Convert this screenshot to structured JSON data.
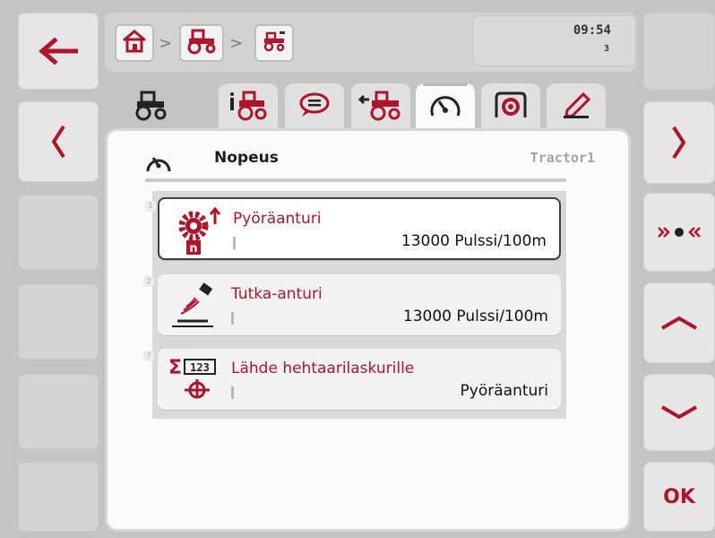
{
  "header": {
    "time": "09:54",
    "counter": "3",
    "breadcrumb": [
      "home-icon",
      "tractor-icon",
      "tractor-small-icon"
    ],
    "separator": ">"
  },
  "tabs": [
    {
      "name": "tractor",
      "icon": "tractor-icon"
    },
    {
      "name": "tractor-info",
      "icon": "tractor-info-icon"
    },
    {
      "name": "messages",
      "icon": "speech-bubble-icon"
    },
    {
      "name": "hitch",
      "icon": "tractor-hitch-icon"
    },
    {
      "name": "speed",
      "icon": "speedometer-icon",
      "active": true
    },
    {
      "name": "pto",
      "icon": "pto-icon"
    },
    {
      "name": "edit",
      "icon": "pencil-icon"
    }
  ],
  "panel": {
    "title": "Nopeus",
    "subtitle": "Tractor1",
    "items": [
      {
        "index": "1",
        "label": "Pyöräanturi",
        "value": "13000 Pulssi/100m",
        "icon": "wheel-sensor-icon"
      },
      {
        "index": "2",
        "label": "Tutka-anturi",
        "value": "13000 Pulssi/100m",
        "icon": "radar-sensor-icon"
      },
      {
        "index": "7",
        "label": "Lähde hehtaarilaskurille",
        "value": "Pyöräanturi",
        "icon": "hectare-counter-source-icon"
      }
    ]
  },
  "side_left": [
    {
      "name": "back",
      "icon": "arrow-left-icon"
    },
    {
      "name": "previous",
      "icon": "chevron-left-icon"
    },
    {
      "name": "empty-1"
    },
    {
      "name": "empty-2"
    },
    {
      "name": "empty-3"
    },
    {
      "name": "empty-4"
    }
  ],
  "side_right": [
    {
      "name": "empty-top"
    },
    {
      "name": "next",
      "icon": "chevron-right-icon"
    },
    {
      "name": "learn",
      "icon": "learn-icon"
    },
    {
      "name": "up",
      "icon": "chevron-up-icon"
    },
    {
      "name": "down",
      "icon": "chevron-down-icon"
    },
    {
      "name": "ok",
      "label": "OK"
    }
  ],
  "colors": {
    "accent_red": "#b0142a",
    "panel_bg": "#fbfbfb",
    "frame": "#c4c4c4"
  }
}
